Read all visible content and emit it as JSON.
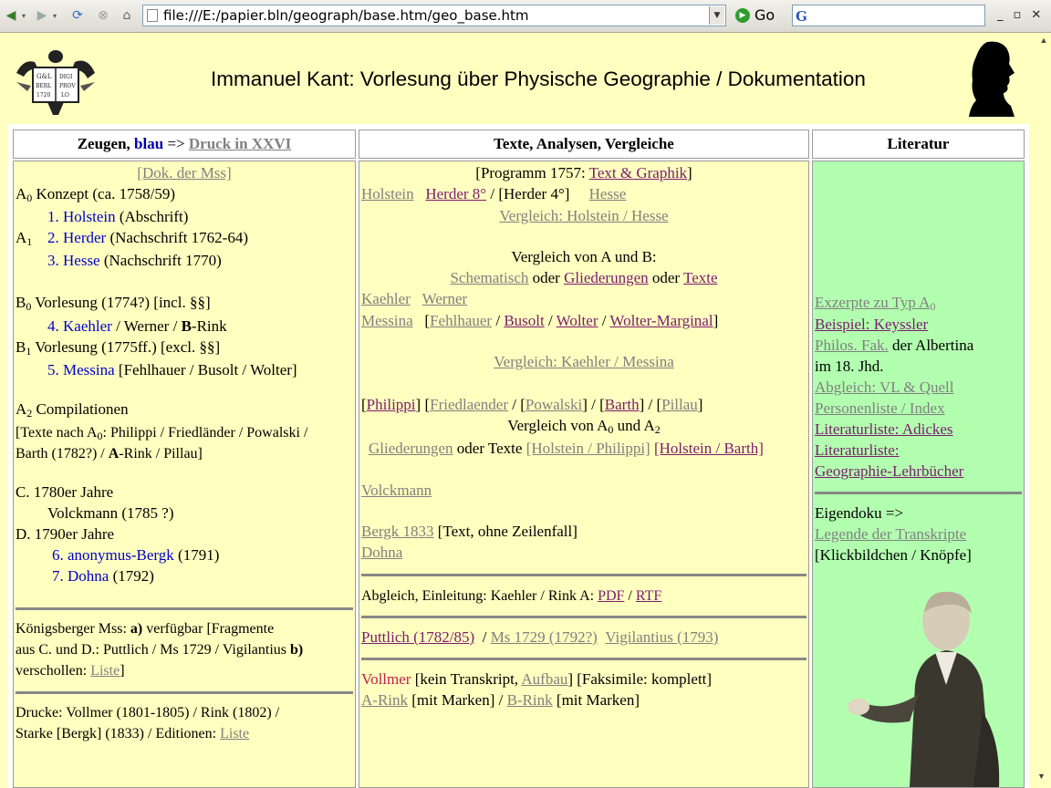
{
  "browser": {
    "url": "file:///E:/papier.bln/geograph/base.htm/geo_base.htm",
    "go_label": "Go",
    "search_glyph": "G",
    "win_minimize": "_",
    "win_restore": "▫",
    "win_close": "✕"
  },
  "page": {
    "title": "Immanuel Kant: Vorlesung über Physische Geographie / Dokumentation",
    "logo_lines": [
      "G&L",
      "DIGI",
      "BERLIN",
      "PROV",
      "1720",
      "LO"
    ]
  },
  "col1": {
    "head_zeugen": "Zeugen,",
    "head_blau": "blau",
    "head_arrow": " => ",
    "head_link": "Druck in XXVI",
    "dok_mss": "[Dok. der Mss]",
    "a0": "A",
    "a0_rest": " Konzept (ca. 1758/59)",
    "item1_link": "1. Holstein",
    "item1_rest": " (Abschrift)",
    "a1": "A",
    "item2_link": "2. Herder",
    "item2_rest": " (Nachschrift 1762-64)",
    "item3_link": "3. Hesse",
    "item3_rest": " (Nachschrift 1770)",
    "b0": "B",
    "b0_rest": " Vorlesung (1774?) [incl. §§]",
    "item4_link": "4. Kaehler",
    "item4_rest": " / Werner / ",
    "item4_b": "B",
    "item4_end": "-Rink",
    "b1": "B",
    "b1_rest": " Vorlesung (1775ff.) [excl. §§]",
    "item5_link": "5. Messina",
    "item5_rest": " [Fehlhauer / Busolt / Wolter]",
    "a2": "A",
    "a2_rest": " Compilationen",
    "texte_nach_a": "[Texte nach A",
    "texte_nach_rest": ":  Philippi / Friedländer / Powalski /",
    "barth_a": "Barth (1782?) / ",
    "barth_b": "A",
    "barth_c": "-Rink / Pillau]",
    "c_1780": "C. 1780er Jahre",
    "volckmann": "Volckmann (1785 ?)",
    "d_1790": "D. 1790er Jahre",
    "item6_link": "6. anonymus-Bergk",
    "item6_rest": " (1791)",
    "item7_link": "7. Dohna",
    "item7_rest": " (1792)",
    "koenigsberger_a": "Königsberger Mss: ",
    "koenigsberger_b": "a)",
    "koenigsberger_c": " verfügbar [Fragmente",
    "koenigsberger_d": "aus C. und D.:  Puttlich / Ms 1729 / Vigilantius ",
    "koenigsberger_e": "b)",
    "verschollen": "verschollen: ",
    "liste1": "Liste",
    "bracket_close": "]",
    "drucke_a": "Drucke:  Vollmer (1801-1805) / Rink (1802) /",
    "drucke_b": "Starke [Bergk] (1833)  / Editionen: ",
    "liste2": "Liste"
  },
  "col2": {
    "head": "Texte, Analysen, Vergleiche",
    "programm_a": "[Programm 1757: ",
    "programm_link": "Text & Graphik",
    "programm_b": "]",
    "holstein": "Holstein",
    "herder8": "Herder 8°",
    "slash": " / ",
    "herder4": " [Herder 4°]",
    "hesse": "Hesse",
    "vergleich_hh": "Vergleich: Holstein / Hesse",
    "vergleich_ab": "Vergleich von A und B:",
    "schematisch": "Schematisch",
    "oder1": " oder ",
    "gliederungen1": "Gliederungen",
    "oder2": " oder ",
    "texte1": "Texte",
    "kaehler": "Kaehler",
    "werner": "Werner",
    "messina": "Messina",
    "fehlhauer": "Fehlhauer",
    "busolt": "Busolt",
    "wolter": "Wolter",
    "wolter_marginal": "Wolter-Marginal",
    "vergleich_km": "Vergleich: Kaehler / Messina",
    "philippi": "Philippi",
    "friedlaender": "Friedlaender",
    "powalski": "Powalski",
    "barth": "Barth",
    "pillau": "Pillau",
    "vergleich_a0a2_a": "Vergleich von A",
    "vergleich_a0a2_b": " und A",
    "gliederungen2": "Gliederungen",
    "oder_texte": " oder Texte ",
    "holstein_philippi": "[Holstein / Philippi]",
    "holstein_barth": "[Holstein / Barth]",
    "volckmann": "Volckmann",
    "bergk1833": "Bergk 1833",
    "bergk_rest": " [Text, ohne Zeilenfall]",
    "dohna": "Dohna",
    "abgleich": "Abgleich, Einleitung: Kaehler / Rink A: ",
    "pdf": "PDF",
    "rtf": "RTF",
    "puttlich": "Puttlich (1782/85)",
    "ms1729": "Ms 1729 (1792?)",
    "vigilantius": "Vigilantius (1793)",
    "vollmer": "Vollmer",
    "vollmer_rest": " [kein Transkript, ",
    "aufbau": "Aufbau",
    "faksimile": "] [Faksimile: komplett]",
    "a_rink": "A-Rink",
    "mit_marken1": " [mit Marken]  /  ",
    "b_rink": "B-Rink",
    "mit_marken2": " [mit Marken]"
  },
  "col3": {
    "head": "Literatur",
    "exzerpte": "Exzerpte zu Typ A",
    "beispiel": "Beispiel: Keyssler",
    "philos": "Philos. Fak.",
    "albertina_a": " der Albertina",
    "albertina_b": "im 18. Jhd.",
    "abgleich": "Abgleich: VL & Quell",
    "personenliste": "Personenliste / Index",
    "lit_adickes": "Literaturliste: Adickes",
    "lit_a": "Literaturliste:",
    "lit_b": "Geographie-Lehrbücher",
    "eigendoku": "Eigendoku =>",
    "legende": "Legende der Transkripte",
    "klickbild": "[Klickbildchen / Knöpfe]"
  },
  "subs": {
    "zero": "0",
    "one": "1",
    "two": "2"
  }
}
